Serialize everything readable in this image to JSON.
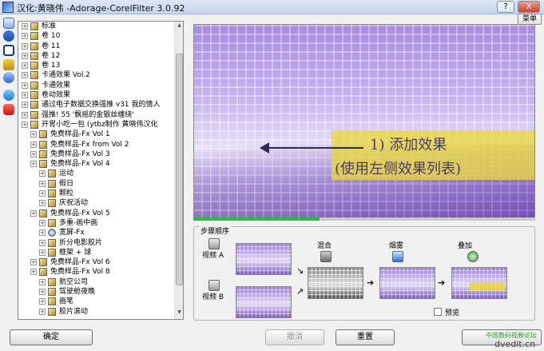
{
  "window": {
    "title": "汉化:黄晓伟 -Adorage-CorelFilter 3.0.92",
    "help_label": "?",
    "close_label": "X"
  },
  "menu": {
    "label": "菜单"
  },
  "tree": {
    "items": [
      {
        "depth": 0,
        "label": "标准",
        "icon": "folder-icon"
      },
      {
        "depth": 0,
        "label": "卷 10",
        "icon": "folder-icon"
      },
      {
        "depth": 0,
        "label": "卷 11",
        "icon": "folder-icon"
      },
      {
        "depth": 0,
        "label": "卷 12",
        "icon": "folder-icon"
      },
      {
        "depth": 0,
        "label": "卷 13",
        "icon": "folder-icon"
      },
      {
        "depth": 0,
        "label": "卡通效果 Vol.2",
        "icon": "folder-icon"
      },
      {
        "depth": 0,
        "label": "卡通效果",
        "icon": "folder-icon"
      },
      {
        "depth": 0,
        "label": "卷动效果",
        "icon": "folder-icon"
      },
      {
        "depth": 0,
        "label": "通过电子数据交换强推 v31 我的情人",
        "icon": "folder-icon"
      },
      {
        "depth": 0,
        "label": "强推! 55 '飘摇的金银丝缠绕'",
        "icon": "folder-icon"
      },
      {
        "depth": 0,
        "label": "开胃小吃一包 (ytbz制作 黄晓伟汉化",
        "icon": "folder-icon"
      },
      {
        "depth": 1,
        "label": "免费样品-Fx Vol 1",
        "icon": "folder-icon"
      },
      {
        "depth": 1,
        "label": "免费样品-Fx from Vol 2",
        "icon": "folder-icon"
      },
      {
        "depth": 1,
        "label": "免费样品-Fx Vol 3",
        "icon": "folder-icon"
      },
      {
        "depth": 1,
        "label": "免费样品-Fx Vol 4",
        "icon": "folder-icon"
      },
      {
        "depth": 2,
        "label": "运动",
        "icon": "folder-icon"
      },
      {
        "depth": 2,
        "label": "假日",
        "icon": "folder-icon"
      },
      {
        "depth": 2,
        "label": "颗粒",
        "icon": "folder-icon"
      },
      {
        "depth": 2,
        "label": "庆祝活动",
        "icon": "folder-icon"
      },
      {
        "depth": 1,
        "label": "免费样品-Fx Vol 5",
        "icon": "folder-icon"
      },
      {
        "depth": 2,
        "label": "多重-画中画",
        "icon": "folder-icon"
      },
      {
        "depth": 2,
        "label": "宽屏-Fx",
        "icon": "effect-icon"
      },
      {
        "depth": 2,
        "label": "折分电影胶片",
        "icon": "folder-icon"
      },
      {
        "depth": 2,
        "label": "框架 + 球",
        "icon": "folder-icon"
      },
      {
        "depth": 1,
        "label": "免费样品-Fx Vol 6",
        "icon": "folder-icon"
      },
      {
        "depth": 1,
        "label": "免费样品-Fx Vol 8",
        "icon": "folder-icon"
      },
      {
        "depth": 2,
        "label": "航空公司",
        "icon": "folder-icon"
      },
      {
        "depth": 2,
        "label": "驾驶舱夜晚",
        "icon": "folder-icon"
      },
      {
        "depth": 2,
        "label": "画笔",
        "icon": "folder-icon"
      },
      {
        "depth": 2,
        "label": "胶片滚动",
        "icon": "folder-icon"
      }
    ]
  },
  "preview": {
    "caption_line1": "1) 添加效果",
    "caption_line2": "(使用左侧效果列表)",
    "progress_fraction": 0.37
  },
  "steps": {
    "title": "步骤顺序",
    "video_a_label": "视频 A",
    "video_b_label": "视频 B",
    "mix_label": "混合",
    "fog_label": "烟雾",
    "overlay_label": "叠加",
    "preview_checkbox_label": "预览"
  },
  "buttons": {
    "ok_label": "确定",
    "undo_label": "撤消",
    "reset_label": "重置"
  },
  "watermark": {
    "line1": "中国数码视频论坛",
    "line2": "dvedit.cn"
  },
  "colors": {
    "progress": "#2bbf3b",
    "caption_band": "#e8d73c",
    "tree_border": "#828790"
  }
}
